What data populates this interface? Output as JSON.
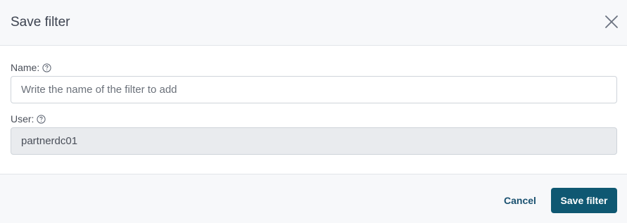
{
  "modal": {
    "title": "Save filter"
  },
  "fields": {
    "name": {
      "label": "Name:",
      "value": "",
      "placeholder": "Write the name of the filter to add"
    },
    "user": {
      "label": "User:",
      "value": "partnerdc01"
    }
  },
  "footer": {
    "cancel_label": "Cancel",
    "save_label": "Save filter"
  },
  "icons": {
    "close": "close-icon",
    "help": "help-circle-icon"
  },
  "colors": {
    "primary": "#0f5872",
    "link": "#1a5170",
    "header_bg": "#f7f8fa",
    "readonly_bg": "#e9ebee"
  }
}
